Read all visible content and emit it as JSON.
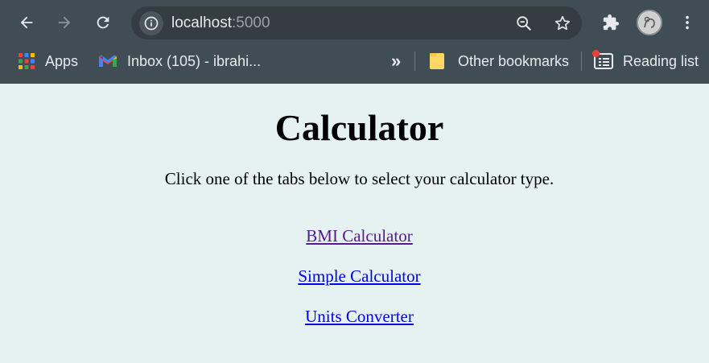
{
  "browser": {
    "url_host": "localhost",
    "url_port": ":5000",
    "bookmarks": {
      "apps_label": "Apps",
      "gmail_label": "Inbox (105) - ibrahi...",
      "overflow_label": "»",
      "other_label": "Other bookmarks",
      "reading_list_label": "Reading list"
    },
    "colors": {
      "chrome": "#404d54",
      "omnibox": "#333d42",
      "text": "#e8eaed"
    }
  },
  "page": {
    "title": "Calculator",
    "intro": "Click one of the tabs below to select your calculator type.",
    "links": [
      {
        "label": "BMI Calculator",
        "visited": true
      },
      {
        "label": "Simple Calculator",
        "visited": false
      },
      {
        "label": "Units Converter",
        "visited": false
      }
    ],
    "background": "#e6f1f1"
  }
}
